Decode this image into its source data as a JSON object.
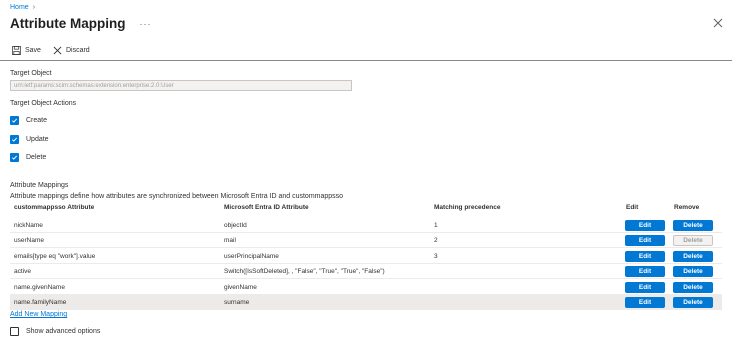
{
  "breadcrumb": {
    "home": "Home",
    "chevron": "›"
  },
  "title": "Attribute Mapping",
  "more_icon": "more-icon",
  "close_icon": "close-icon",
  "toolbar": {
    "save_label": "Save",
    "discard_label": "Discard"
  },
  "target_object": {
    "label": "Target Object",
    "value": "urn:ietf:params:scim:schemas:extension:enterprise:2.0:User"
  },
  "target_actions": {
    "label": "Target Object Actions",
    "items": [
      {
        "label": "Create",
        "checked": true
      },
      {
        "label": "Update",
        "checked": true
      },
      {
        "label": "Delete",
        "checked": true
      }
    ]
  },
  "mappings": {
    "label": "Attribute Mappings",
    "description": "Attribute mappings define how attributes are synchronized between Microsoft Entra ID and custommappsso",
    "columns": [
      "custommappsso Attribute",
      "Microsoft Entra ID Attribute",
      "Matching precedence",
      "Edit",
      "Remove"
    ],
    "edit_label": "Edit",
    "delete_label": "Delete",
    "rows": [
      {
        "target": "nickName",
        "source": "objectId",
        "precedence": "1",
        "delete_enabled": true
      },
      {
        "target": "userName",
        "source": "mail",
        "precedence": "2",
        "delete_enabled": false
      },
      {
        "target": "emails[type eq \"work\"].value",
        "source": "userPrincipalName",
        "precedence": "3",
        "delete_enabled": true
      },
      {
        "target": "active",
        "source": "Switch([IsSoftDeleted], , \"False\", \"True\", \"True\", \"False\")",
        "precedence": "",
        "delete_enabled": true
      },
      {
        "target": "name.givenName",
        "source": "givenName",
        "precedence": "",
        "delete_enabled": true
      },
      {
        "target": "name.familyName",
        "source": "surname",
        "precedence": "",
        "delete_enabled": true
      }
    ],
    "add_link": "Add New Mapping"
  },
  "advanced": {
    "label": "Show advanced options",
    "checked": false
  }
}
